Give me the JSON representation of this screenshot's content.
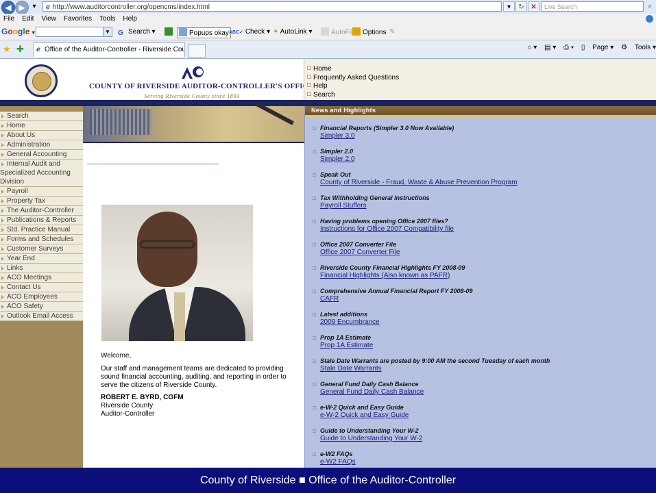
{
  "browser": {
    "url": "http://www.auditorcontroller.org/opencms/index.html",
    "search_placeholder": "Live Search",
    "menu": [
      "File",
      "Edit",
      "View",
      "Favorites",
      "Tools",
      "Help"
    ],
    "tab_title": "Office of the Auditor-Controller - Riverside County -",
    "command_bar": [
      "Page",
      "Tools"
    ],
    "google_toolbar": {
      "brand": "Google",
      "search_label": "Search",
      "popups_label": "Popups okay",
      "check_label": "Check",
      "autolink_label": "AutoLink",
      "autofill_label": "AutoFill",
      "options_label": "Options"
    }
  },
  "header": {
    "office_title": "COUNTY OF RIVERSIDE AUDITOR-CONTROLLER'S OFFICE",
    "office_subtitle": "Serving Riverside County since 1893",
    "top_links": [
      "Home",
      "Frequently Asked Questions",
      "Help",
      "Search"
    ]
  },
  "left_nav": [
    "Search",
    "Home",
    "About Us",
    "Administration",
    "General Accounting",
    "Internal Audit and Specialized Accounting Division",
    "Payroll",
    "Property Tax",
    "The Auditor-Controller",
    "Publications & Reports",
    "Std. Practice Manual",
    "Forms and Schedules",
    "Customer Surveys",
    "Year End",
    "Links",
    "ACO Meetings",
    "Contact Us",
    "ACO Employees",
    "ACO Safety",
    "Outlook Email Access"
  ],
  "center": {
    "welcome": "Welcome,",
    "mission": "Our staff and management teams are dedicated to providing sound financial accounting, auditing, and reporting in order to serve the citizens of Riverside County.",
    "signature_name": "ROBERT E. BYRD, CGFM",
    "signature_county": "Riverside County",
    "signature_title": "Auditor-Controller"
  },
  "news": {
    "heading": "News and Highlights",
    "items": [
      {
        "title": "Financial Reports (Simpler 3.0 Now Available)",
        "link": "Simpler 3.0"
      },
      {
        "title": "Simpler 2.0",
        "link": "Simpler 2.0"
      },
      {
        "title": "Speak Out",
        "link": "County of Riverside - Fraud, Waste & Abuse Prevention Program"
      },
      {
        "title": "Tax Withholding General Instructions",
        "link": "Payroll Stuffers"
      },
      {
        "title": "Having problems opening Office 2007 files?",
        "link": "Instructions for Office 2007 Compatibility file"
      },
      {
        "title": "Office 2007 Converter File",
        "link": "Office 2007 Converter File"
      },
      {
        "title": "Riverside County Financial Highlights FY 2008-09",
        "link": "Financial Highlights (Also known as PAFR)"
      },
      {
        "title": "Comprehensive Annual Financial Report FY 2008-09",
        "link": "CAFR"
      },
      {
        "title": "Latest additions",
        "link": "2009 Encumbrance"
      },
      {
        "title": "Prop 1A Estimate",
        "link": "Prop 1A Estimate"
      },
      {
        "title": "Stale Date Warrants are posted by 9:00 AM the second Tuesday of each month",
        "link": "Stale Date Warrants"
      },
      {
        "title": "General Fund Daily Cash Balance",
        "link": "General Fund Daily Cash Balance"
      },
      {
        "title": "e-W-2 Quick and Easy Guide",
        "link": "e-W-2 Quick and Easy Guide"
      },
      {
        "title": "Guide to Understanding Your W-2",
        "link": "Guide to Understanding Your W-2"
      },
      {
        "title": "e-W2 FAQs",
        "link": "e-W2 FAQs"
      }
    ]
  },
  "footer": {
    "left": "County of Riverside",
    "separator": "■",
    "right": "Office of the Auditor-Controller"
  }
}
